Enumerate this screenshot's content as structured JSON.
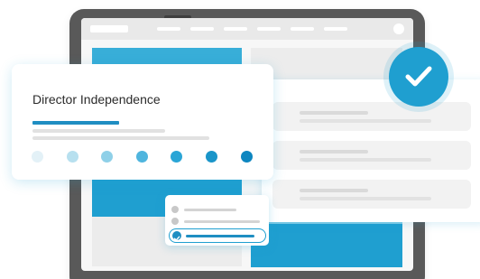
{
  "card": {
    "title": "Director Independence",
    "progress_fraction": 0.33,
    "rating_dots": [
      {
        "color": "#e3f1f7"
      },
      {
        "color": "#b7e0ef"
      },
      {
        "color": "#8fd0e8"
      },
      {
        "color": "#4fb5de"
      },
      {
        "color": "#2aa5d6"
      },
      {
        "color": "#1a95c9"
      },
      {
        "color": "#0d86c0"
      }
    ]
  },
  "mini_popup": {
    "selected_index": 2,
    "option_count": 3
  },
  "list_rows": {
    "count": 3
  },
  "status": {
    "check_icon": "checkmark-icon",
    "badge_color": "#1f9fd0"
  },
  "colors": {
    "accent": "#1f9fd0",
    "accent_dark": "#1f8ec2",
    "device_frame": "#595959"
  }
}
